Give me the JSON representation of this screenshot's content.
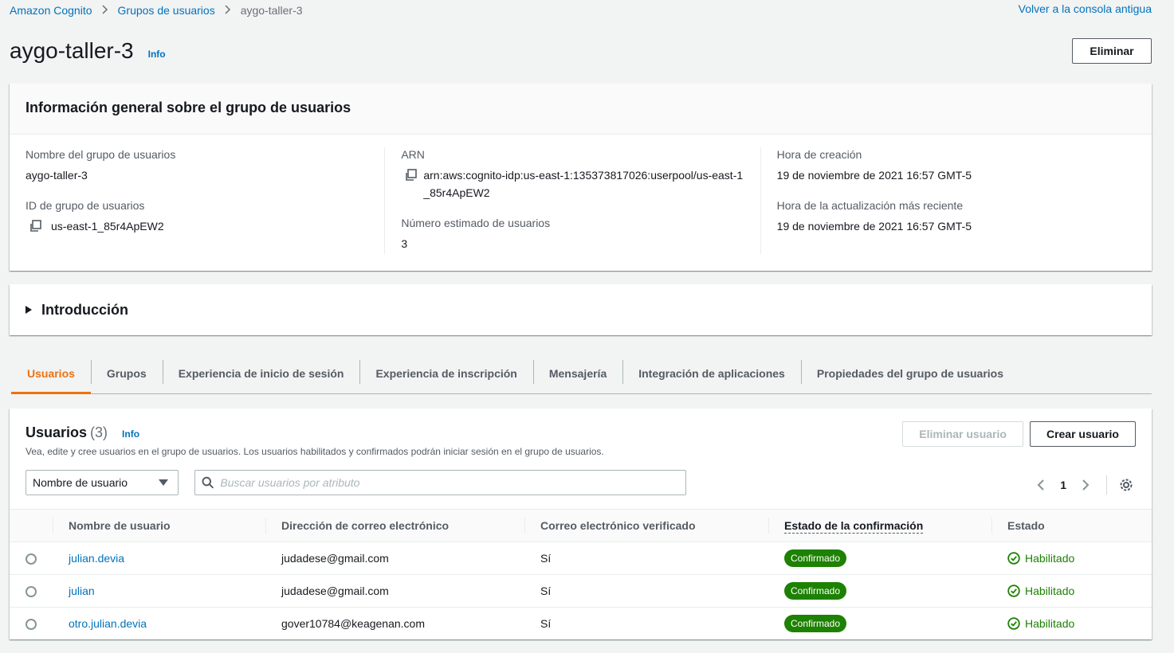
{
  "breadcrumb": {
    "items": [
      "Amazon Cognito",
      "Grupos de usuarios"
    ],
    "current": "aygo-taller-3"
  },
  "back_link": "Volver a la consola antigua",
  "header": {
    "title": "aygo-taller-3",
    "info": "Info",
    "delete_label": "Eliminar"
  },
  "general_info": {
    "title": "Información general sobre el grupo de usuarios",
    "pool_name_label": "Nombre del grupo de usuarios",
    "pool_name": "aygo-taller-3",
    "pool_id_label": "ID de grupo de usuarios",
    "pool_id": "us-east-1_85r4ApEW2",
    "arn_label": "ARN",
    "arn": "arn:aws:cognito-idp:us-east-1:135373817026:userpool/us-east-1_85r4ApEW2",
    "estimated_users_label": "Número estimado de usuarios",
    "estimated_users": "3",
    "created_label": "Hora de creación",
    "created": "19 de noviembre de 2021 16:57 GMT-5",
    "updated_label": "Hora de la actualización más reciente",
    "updated": "19 de noviembre de 2021 16:57 GMT-5"
  },
  "intro": {
    "title": "Introducción"
  },
  "tabs": [
    {
      "label": "Usuarios",
      "active": true
    },
    {
      "label": "Grupos"
    },
    {
      "label": "Experiencia de inicio de sesión"
    },
    {
      "label": "Experiencia de inscripción"
    },
    {
      "label": "Mensajería"
    },
    {
      "label": "Integración de aplicaciones"
    },
    {
      "label": "Propiedades del grupo de usuarios"
    }
  ],
  "users": {
    "title": "Usuarios",
    "count": "(3)",
    "info": "Info",
    "description": "Vea, edite y cree usuarios en el grupo de usuarios. Los usuarios habilitados y confirmados podrán iniciar sesión en el grupo de usuarios.",
    "delete_user_label": "Eliminar usuario",
    "create_user_label": "Crear usuario",
    "filter_select": "Nombre de usuario",
    "search_placeholder": "Buscar usuarios por atributo",
    "page": "1",
    "columns": [
      "Nombre de usuario",
      "Dirección de correo electrónico",
      "Correo electrónico verificado",
      "Estado de la confirmación",
      "Estado"
    ],
    "rows": [
      {
        "username": "julian.devia",
        "email": "judadese@gmail.com",
        "verified": "Sí",
        "confirmation": "Confirmado",
        "status": "Habilitado"
      },
      {
        "username": "julian",
        "email": "judadese@gmail.com",
        "verified": "Sí",
        "confirmation": "Confirmado",
        "status": "Habilitado"
      },
      {
        "username": "otro.julian.devia",
        "email": "gover10784@keagenan.com",
        "verified": "Sí",
        "confirmation": "Confirmado",
        "status": "Habilitado"
      }
    ]
  },
  "colors": {
    "link": "#0073bb",
    "accent": "#ec7211",
    "success": "#1d8102"
  }
}
